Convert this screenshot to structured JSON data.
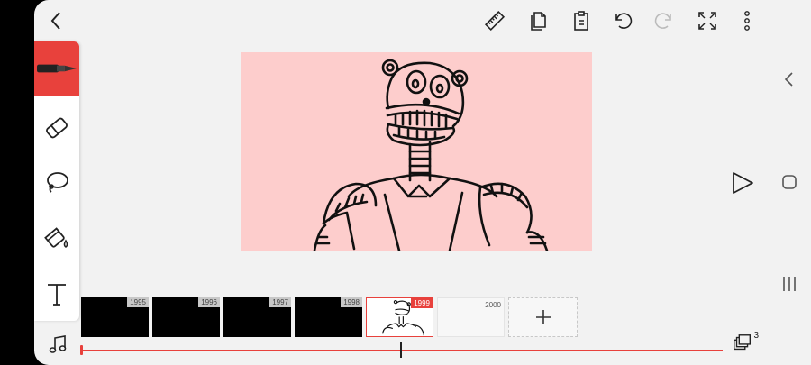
{
  "toolbar": {
    "icons": [
      "back-chevron-icon",
      "ruler-icon",
      "copy-icon",
      "paste-icon",
      "undo-icon",
      "redo-icon",
      "fullscreen-icon",
      "more-vert-icon"
    ]
  },
  "tools": {
    "items": [
      {
        "name": "pen",
        "icon": "pen-icon",
        "active": true
      },
      {
        "name": "eraser",
        "icon": "eraser-icon",
        "active": false
      },
      {
        "name": "lasso",
        "icon": "lasso-icon",
        "active": false
      },
      {
        "name": "fill",
        "icon": "fill-bucket-icon",
        "active": false
      },
      {
        "name": "text",
        "icon": "text-tool-icon",
        "active": false
      }
    ]
  },
  "frames": [
    {
      "number": "1995",
      "state": "filled"
    },
    {
      "number": "1996",
      "state": "filled"
    },
    {
      "number": "1997",
      "state": "filled"
    },
    {
      "number": "1998",
      "state": "filled"
    },
    {
      "number": "1999",
      "state": "current"
    },
    {
      "number": "2000",
      "state": "blank"
    }
  ],
  "layers": {
    "count": "3"
  },
  "colors": {
    "accent": "#e8413c",
    "canvas": "#fdcdcc",
    "background": "#f2f2f2"
  }
}
